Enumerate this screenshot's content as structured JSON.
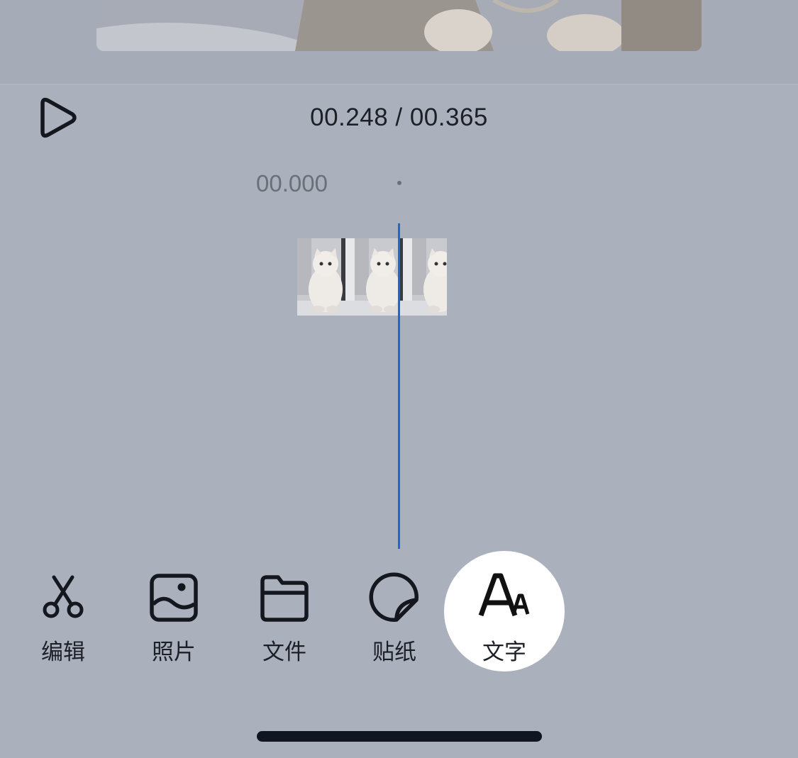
{
  "player": {
    "time_readout": "00.248 / 00.365",
    "play_icon": "play-icon"
  },
  "timeline": {
    "start_label": "00.000",
    "thumbnail_count": 3
  },
  "toolbar": {
    "items": [
      {
        "label": "编辑",
        "icon": "scissors-icon"
      },
      {
        "label": "照片",
        "icon": "image-icon"
      },
      {
        "label": "文件",
        "icon": "folder-icon"
      },
      {
        "label": "贴纸",
        "icon": "sticker-icon"
      },
      {
        "label": "文字",
        "icon": "text-icon"
      }
    ],
    "active_index": 4
  },
  "colors": {
    "background": "#abb0bd",
    "playhead": "#1e66d0",
    "active_bubble": "#ffffff",
    "text": "#1c1f26"
  }
}
